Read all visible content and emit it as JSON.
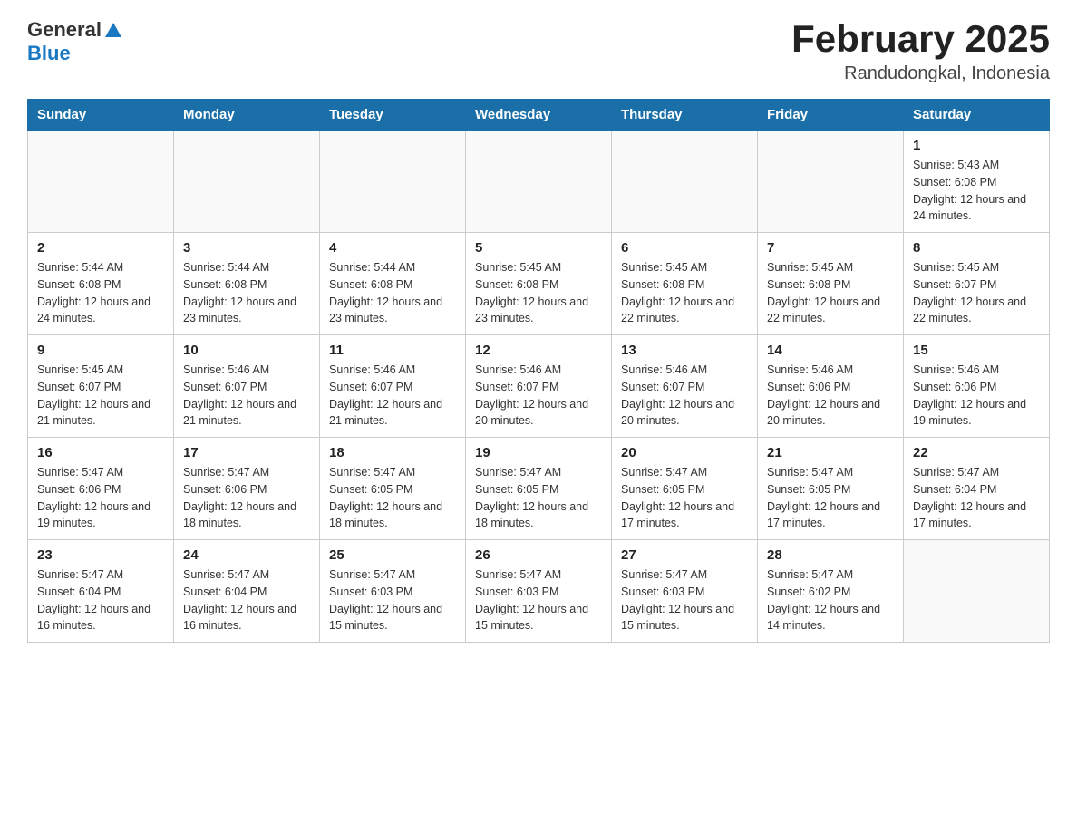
{
  "logo": {
    "text_general": "General",
    "text_blue": "Blue",
    "arrow": "▲"
  },
  "title": {
    "month_year": "February 2025",
    "location": "Randudongkal, Indonesia"
  },
  "weekdays": [
    "Sunday",
    "Monday",
    "Tuesday",
    "Wednesday",
    "Thursday",
    "Friday",
    "Saturday"
  ],
  "weeks": [
    [
      {
        "day": "",
        "info": ""
      },
      {
        "day": "",
        "info": ""
      },
      {
        "day": "",
        "info": ""
      },
      {
        "day": "",
        "info": ""
      },
      {
        "day": "",
        "info": ""
      },
      {
        "day": "",
        "info": ""
      },
      {
        "day": "1",
        "info": "Sunrise: 5:43 AM\nSunset: 6:08 PM\nDaylight: 12 hours and 24 minutes."
      }
    ],
    [
      {
        "day": "2",
        "info": "Sunrise: 5:44 AM\nSunset: 6:08 PM\nDaylight: 12 hours and 24 minutes."
      },
      {
        "day": "3",
        "info": "Sunrise: 5:44 AM\nSunset: 6:08 PM\nDaylight: 12 hours and 23 minutes."
      },
      {
        "day": "4",
        "info": "Sunrise: 5:44 AM\nSunset: 6:08 PM\nDaylight: 12 hours and 23 minutes."
      },
      {
        "day": "5",
        "info": "Sunrise: 5:45 AM\nSunset: 6:08 PM\nDaylight: 12 hours and 23 minutes."
      },
      {
        "day": "6",
        "info": "Sunrise: 5:45 AM\nSunset: 6:08 PM\nDaylight: 12 hours and 22 minutes."
      },
      {
        "day": "7",
        "info": "Sunrise: 5:45 AM\nSunset: 6:08 PM\nDaylight: 12 hours and 22 minutes."
      },
      {
        "day": "8",
        "info": "Sunrise: 5:45 AM\nSunset: 6:07 PM\nDaylight: 12 hours and 22 minutes."
      }
    ],
    [
      {
        "day": "9",
        "info": "Sunrise: 5:45 AM\nSunset: 6:07 PM\nDaylight: 12 hours and 21 minutes."
      },
      {
        "day": "10",
        "info": "Sunrise: 5:46 AM\nSunset: 6:07 PM\nDaylight: 12 hours and 21 minutes."
      },
      {
        "day": "11",
        "info": "Sunrise: 5:46 AM\nSunset: 6:07 PM\nDaylight: 12 hours and 21 minutes."
      },
      {
        "day": "12",
        "info": "Sunrise: 5:46 AM\nSunset: 6:07 PM\nDaylight: 12 hours and 20 minutes."
      },
      {
        "day": "13",
        "info": "Sunrise: 5:46 AM\nSunset: 6:07 PM\nDaylight: 12 hours and 20 minutes."
      },
      {
        "day": "14",
        "info": "Sunrise: 5:46 AM\nSunset: 6:06 PM\nDaylight: 12 hours and 20 minutes."
      },
      {
        "day": "15",
        "info": "Sunrise: 5:46 AM\nSunset: 6:06 PM\nDaylight: 12 hours and 19 minutes."
      }
    ],
    [
      {
        "day": "16",
        "info": "Sunrise: 5:47 AM\nSunset: 6:06 PM\nDaylight: 12 hours and 19 minutes."
      },
      {
        "day": "17",
        "info": "Sunrise: 5:47 AM\nSunset: 6:06 PM\nDaylight: 12 hours and 18 minutes."
      },
      {
        "day": "18",
        "info": "Sunrise: 5:47 AM\nSunset: 6:05 PM\nDaylight: 12 hours and 18 minutes."
      },
      {
        "day": "19",
        "info": "Sunrise: 5:47 AM\nSunset: 6:05 PM\nDaylight: 12 hours and 18 minutes."
      },
      {
        "day": "20",
        "info": "Sunrise: 5:47 AM\nSunset: 6:05 PM\nDaylight: 12 hours and 17 minutes."
      },
      {
        "day": "21",
        "info": "Sunrise: 5:47 AM\nSunset: 6:05 PM\nDaylight: 12 hours and 17 minutes."
      },
      {
        "day": "22",
        "info": "Sunrise: 5:47 AM\nSunset: 6:04 PM\nDaylight: 12 hours and 17 minutes."
      }
    ],
    [
      {
        "day": "23",
        "info": "Sunrise: 5:47 AM\nSunset: 6:04 PM\nDaylight: 12 hours and 16 minutes."
      },
      {
        "day": "24",
        "info": "Sunrise: 5:47 AM\nSunset: 6:04 PM\nDaylight: 12 hours and 16 minutes."
      },
      {
        "day": "25",
        "info": "Sunrise: 5:47 AM\nSunset: 6:03 PM\nDaylight: 12 hours and 15 minutes."
      },
      {
        "day": "26",
        "info": "Sunrise: 5:47 AM\nSunset: 6:03 PM\nDaylight: 12 hours and 15 minutes."
      },
      {
        "day": "27",
        "info": "Sunrise: 5:47 AM\nSunset: 6:03 PM\nDaylight: 12 hours and 15 minutes."
      },
      {
        "day": "28",
        "info": "Sunrise: 5:47 AM\nSunset: 6:02 PM\nDaylight: 12 hours and 14 minutes."
      },
      {
        "day": "",
        "info": ""
      }
    ]
  ]
}
